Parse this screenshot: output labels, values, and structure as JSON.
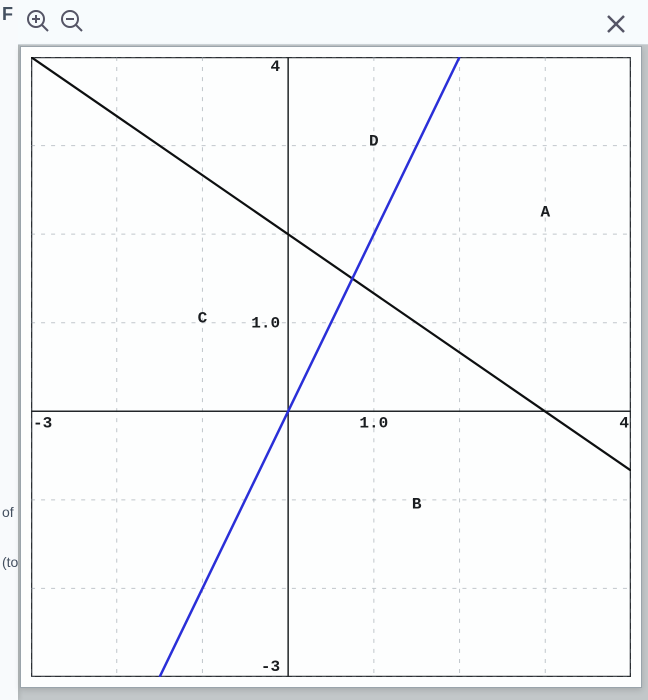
{
  "toolbar": {
    "zoom_in_icon": "zoom-in",
    "zoom_out_icon": "zoom-out",
    "close_icon": "close"
  },
  "side_labels": {
    "f": "F",
    "of": "of",
    "to": "(to"
  },
  "chart_data": {
    "type": "line",
    "xlim": [
      -3,
      4
    ],
    "ylim": [
      -3,
      4
    ],
    "x_grid": [
      -3,
      -2,
      -1,
      0,
      1,
      2,
      3,
      4
    ],
    "y_grid": [
      -3,
      -2,
      -1,
      0,
      1,
      2,
      3,
      4
    ],
    "x_tick_labels": {
      "-3": "-3",
      "1": "1.0",
      "4": "4"
    },
    "y_tick_labels": {
      "-3": "-3",
      "1": "1.0",
      "4": "4"
    },
    "series": [
      {
        "name": "black",
        "color": "#0d0f10",
        "points": [
          {
            "x": -3,
            "y": 4
          },
          {
            "x": 4,
            "y": -0.67
          }
        ]
      },
      {
        "name": "blue",
        "color": "#2a2fd8",
        "points": [
          {
            "x": -1.5,
            "y": -3
          },
          {
            "x": 2.0,
            "y": 4
          }
        ]
      }
    ],
    "region_labels": [
      {
        "text": "A",
        "x": 3.0,
        "y": 2.2
      },
      {
        "text": "B",
        "x": 1.5,
        "y": -1.1
      },
      {
        "text": "C",
        "x": -1.0,
        "y": 1.0
      },
      {
        "text": "D",
        "x": 1.0,
        "y": 3.0
      }
    ]
  }
}
